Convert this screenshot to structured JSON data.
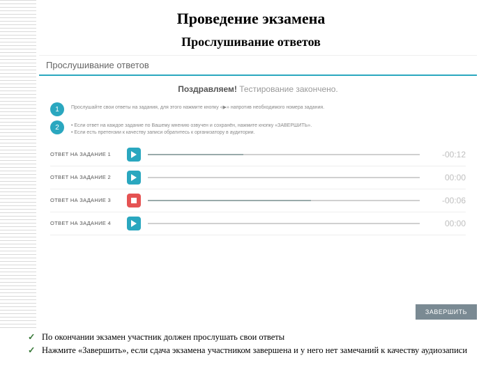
{
  "slide": {
    "title": "Проведение экзамена",
    "subtitle": "Прослушивание ответов"
  },
  "app": {
    "header": "Прослушивание ответов",
    "congrats_bold": "Поздравляем!",
    "congrats_rest": "Тестирование закончено.",
    "steps": [
      {
        "num": "1",
        "text": "Прослушайте свои ответы на задания, для этого нажмите кнопку «▶» напротив необходимого номера задания."
      },
      {
        "num": "2",
        "text": "• Если ответ на каждое задание по Вашему мнению озвучен и сохранён, нажмите кнопку «ЗАВЕРШИТЬ».\n• Если есть претензии к качеству записи обратитесь к организатору в аудитории."
      }
    ],
    "answers": [
      {
        "label": "ОТВЕТ НА ЗАДАНИЕ 1",
        "type": "play",
        "time": "-00:12",
        "progress": 35
      },
      {
        "label": "ОТВЕТ НА ЗАДАНИЕ 2",
        "type": "play",
        "time": "00:00",
        "progress": 0
      },
      {
        "label": "ОТВЕТ НА ЗАДАНИЕ 3",
        "type": "stop",
        "time": "-00:06",
        "progress": 60
      },
      {
        "label": "ОТВЕТ НА ЗАДАНИЕ 4",
        "type": "play",
        "time": "00:00",
        "progress": 0
      }
    ],
    "finish": "ЗАВЕРШИТЬ"
  },
  "bullets": [
    "По окончании экзамен участник должен прослушать свои ответы",
    "Нажмите «Завершить», если сдача экзамена участником завершена и у него нет замечаний к качеству аудиозаписи"
  ]
}
